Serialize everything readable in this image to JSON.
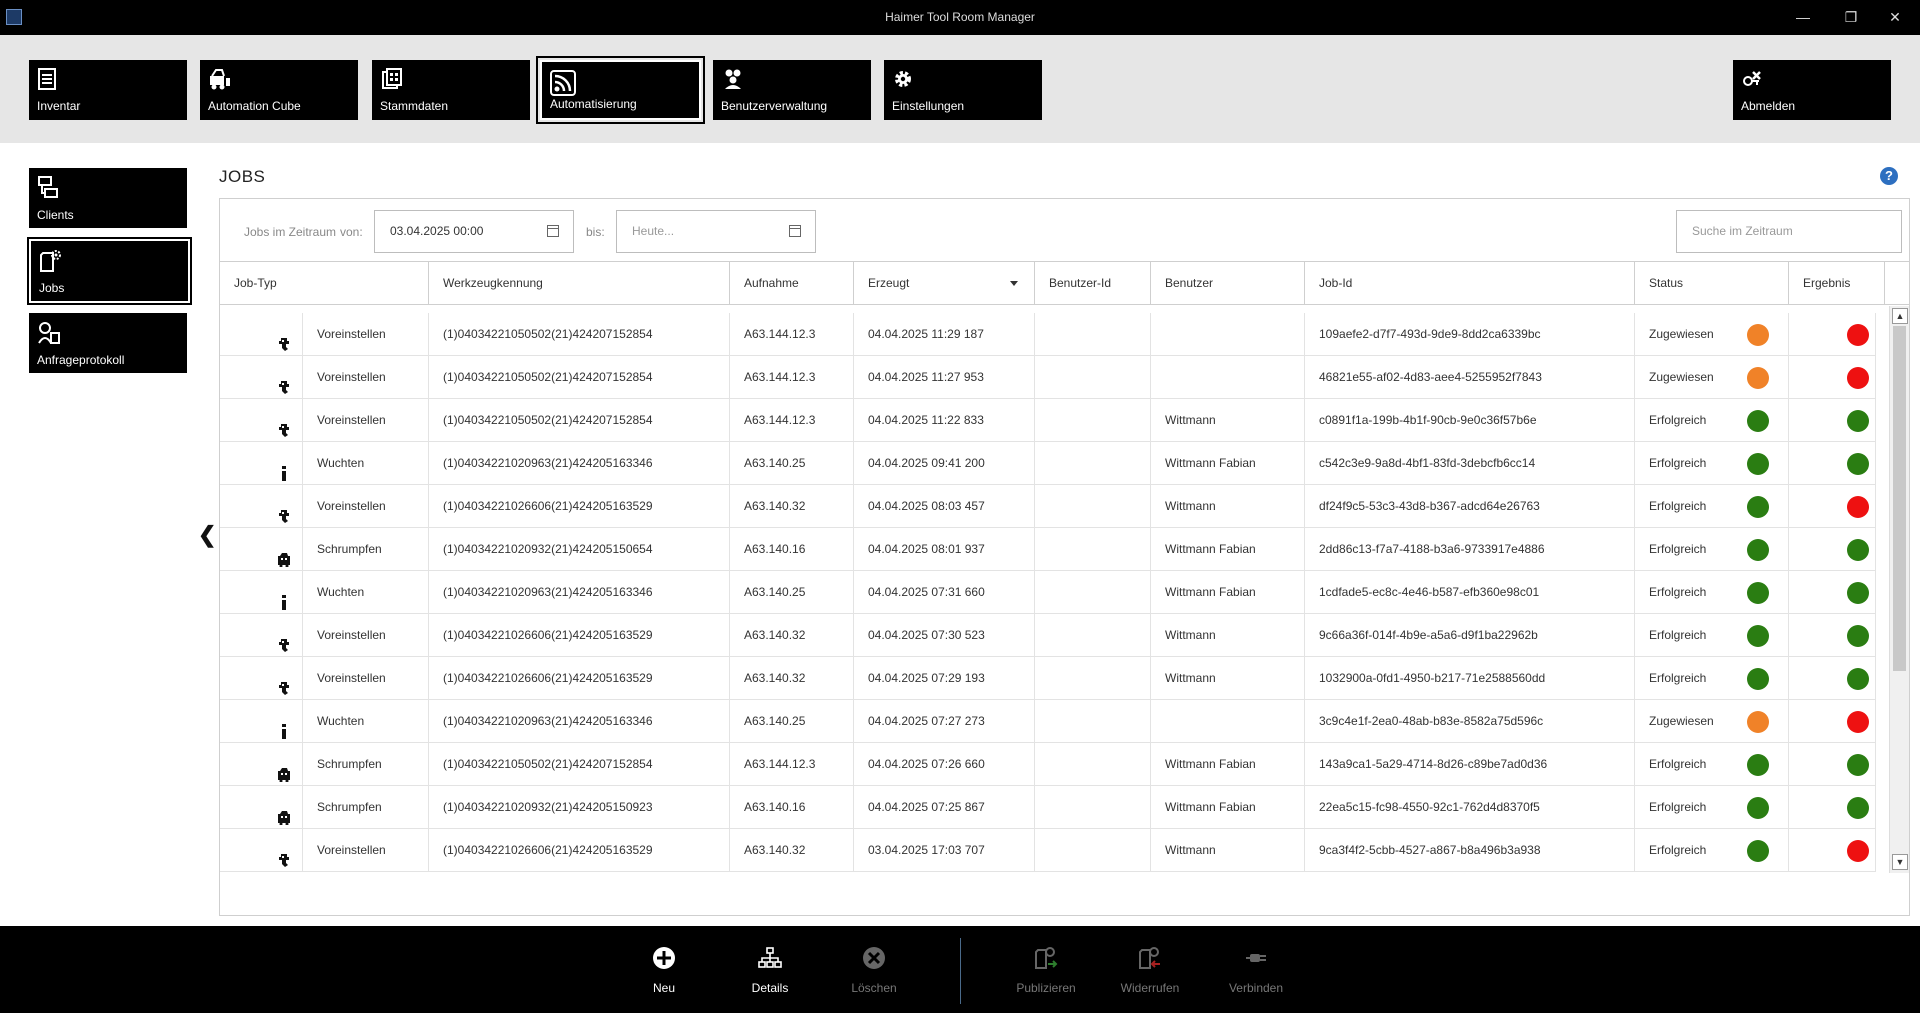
{
  "window": {
    "title": "Haimer Tool Room Manager",
    "minimize": "—",
    "restore": "❐",
    "close": "✕"
  },
  "mainnav": [
    {
      "label": "Inventar",
      "icon": "inventory-icon"
    },
    {
      "label": "Automation Cube",
      "icon": "automation-cube-icon"
    },
    {
      "label": "Stammdaten",
      "icon": "master-data-icon"
    },
    {
      "label": "Automatisierung",
      "icon": "automation-rss-icon",
      "active": true
    },
    {
      "label": "Benutzerverwaltung",
      "icon": "users-icon"
    },
    {
      "label": "Einstellungen",
      "icon": "gear-icon"
    },
    {
      "label": "Abmelden",
      "icon": "logout-icon"
    }
  ],
  "sidenav": [
    {
      "label": "Clients",
      "icon": "clients-icon"
    },
    {
      "label": "Jobs",
      "icon": "jobs-icon",
      "active": true
    },
    {
      "label": "Anfrageprotokoll",
      "icon": "request-log-icon"
    }
  ],
  "page": {
    "title": "JOBS",
    "help": "?"
  },
  "filter": {
    "range_label": "Jobs im Zeitraum",
    "from_label": "von:",
    "from_value": "03.04.2025 00:00",
    "to_label": "bis:",
    "to_placeholder": "Heute...",
    "search_placeholder": "Suche im Zeitraum"
  },
  "table": {
    "columns": [
      "Job-Typ",
      "Werkzeugkennung",
      "Aufnahme",
      "Erzeugt",
      "Benutzer-Id",
      "Benutzer",
      "Job-Id",
      "Status",
      "Ergebnis"
    ],
    "sorted_column": "Erzeugt",
    "rows": [
      {
        "type": "Voreinstellen",
        "icon": "presetting-icon",
        "tool": "(1)04034221050502(21)424207152854",
        "holder": "A63.144.12.3",
        "created": "04.04.2025 11:29 187",
        "user_id": "",
        "user": "",
        "job_id": "109aefe2-d7f7-493d-9de9-8dd2ca6339bc",
        "status": "Zugewiesen",
        "status_color": "#f08228",
        "result_color": "#ee1111"
      },
      {
        "type": "Voreinstellen",
        "icon": "presetting-icon",
        "tool": "(1)04034221050502(21)424207152854",
        "holder": "A63.144.12.3",
        "created": "04.04.2025 11:27 953",
        "user_id": "",
        "user": "",
        "job_id": "46821e55-af02-4d83-aee4-5255952f7843",
        "status": "Zugewiesen",
        "status_color": "#f08228",
        "result_color": "#ee1111"
      },
      {
        "type": "Voreinstellen",
        "icon": "presetting-icon",
        "tool": "(1)04034221050502(21)424207152854",
        "holder": "A63.144.12.3",
        "created": "04.04.2025 11:22 833",
        "user_id": "",
        "user": "Wittmann",
        "job_id": "c0891f1a-199b-4b1f-90cb-9e0c36f57b6e",
        "status": "Erfolgreich",
        "status_color": "#2a7d12",
        "result_color": "#2a7d12"
      },
      {
        "type": "Wuchten",
        "icon": "balancing-icon",
        "tool": "(1)04034221020963(21)424205163346",
        "holder": "A63.140.25",
        "created": "04.04.2025 09:41 200",
        "user_id": "",
        "user": "Wittmann Fabian",
        "job_id": "c542c3e9-9a8d-4bf1-83fd-3debcfb6cc14",
        "status": "Erfolgreich",
        "status_color": "#2a7d12",
        "result_color": "#2a7d12"
      },
      {
        "type": "Voreinstellen",
        "icon": "presetting-icon",
        "tool": "(1)04034221026606(21)424205163529",
        "holder": "A63.140.32",
        "created": "04.04.2025 08:03 457",
        "user_id": "",
        "user": "Wittmann",
        "job_id": "df24f9c5-53c3-43d8-b367-adcd64e26763",
        "status": "Erfolgreich",
        "status_color": "#2a7d12",
        "result_color": "#ee1111"
      },
      {
        "type": "Schrumpfen",
        "icon": "shrinking-icon",
        "tool": "(1)04034221020932(21)424205150654",
        "holder": "A63.140.16",
        "created": "04.04.2025 08:01 937",
        "user_id": "",
        "user": "Wittmann Fabian",
        "job_id": "2dd86c13-f7a7-4188-b3a6-9733917e4886",
        "status": "Erfolgreich",
        "status_color": "#2a7d12",
        "result_color": "#2a7d12"
      },
      {
        "type": "Wuchten",
        "icon": "balancing-icon",
        "tool": "(1)04034221020963(21)424205163346",
        "holder": "A63.140.25",
        "created": "04.04.2025 07:31 660",
        "user_id": "",
        "user": "Wittmann Fabian",
        "job_id": "1cdfade5-ec8c-4e46-b587-efb360e98c01",
        "status": "Erfolgreich",
        "status_color": "#2a7d12",
        "result_color": "#2a7d12"
      },
      {
        "type": "Voreinstellen",
        "icon": "presetting-icon",
        "tool": "(1)04034221026606(21)424205163529",
        "holder": "A63.140.32",
        "created": "04.04.2025 07:30 523",
        "user_id": "",
        "user": "Wittmann",
        "job_id": "9c66a36f-014f-4b9e-a5a6-d9f1ba22962b",
        "status": "Erfolgreich",
        "status_color": "#2a7d12",
        "result_color": "#2a7d12"
      },
      {
        "type": "Voreinstellen",
        "icon": "presetting-icon",
        "tool": "(1)04034221026606(21)424205163529",
        "holder": "A63.140.32",
        "created": "04.04.2025 07:29 193",
        "user_id": "",
        "user": "Wittmann",
        "job_id": "1032900a-0fd1-4950-b217-71e2588560dd",
        "status": "Erfolgreich",
        "status_color": "#2a7d12",
        "result_color": "#2a7d12"
      },
      {
        "type": "Wuchten",
        "icon": "balancing-icon",
        "tool": "(1)04034221020963(21)424205163346",
        "holder": "A63.140.25",
        "created": "04.04.2025 07:27 273",
        "user_id": "",
        "user": "",
        "job_id": "3c9c4e1f-2ea0-48ab-b83e-8582a75d596c",
        "status": "Zugewiesen",
        "status_color": "#f08228",
        "result_color": "#ee1111"
      },
      {
        "type": "Schrumpfen",
        "icon": "shrinking-icon",
        "tool": "(1)04034221050502(21)424207152854",
        "holder": "A63.144.12.3",
        "created": "04.04.2025 07:26 660",
        "user_id": "",
        "user": "Wittmann Fabian",
        "job_id": "143a9ca1-5a29-4714-8d26-c89be7ad0d36",
        "status": "Erfolgreich",
        "status_color": "#2a7d12",
        "result_color": "#2a7d12"
      },
      {
        "type": "Schrumpfen",
        "icon": "shrinking-icon",
        "tool": "(1)04034221020932(21)424205150923",
        "holder": "A63.140.16",
        "created": "04.04.2025 07:25 867",
        "user_id": "",
        "user": "Wittmann Fabian",
        "job_id": "22ea5c15-fc98-4550-92c1-762d4d8370f5",
        "status": "Erfolgreich",
        "status_color": "#2a7d12",
        "result_color": "#2a7d12"
      },
      {
        "type": "Voreinstellen",
        "icon": "presetting-icon",
        "tool": "(1)04034221026606(21)424205163529",
        "holder": "A63.140.32",
        "created": "03.04.2025 17:03 707",
        "user_id": "",
        "user": "Wittmann",
        "job_id": "9ca3f4f2-5cbb-4527-a867-b8a496b3a938",
        "status": "Erfolgreich",
        "status_color": "#2a7d12",
        "result_color": "#ee1111"
      }
    ]
  },
  "toolbar": [
    {
      "label": "Neu",
      "icon": "add-circle-icon",
      "enabled": true
    },
    {
      "label": "Details",
      "icon": "hierarchy-icon",
      "enabled": true
    },
    {
      "label": "Löschen",
      "icon": "delete-x-icon",
      "enabled": false
    },
    {
      "label": "Publizieren",
      "icon": "publish-icon",
      "enabled": false
    },
    {
      "label": "Widerrufen",
      "icon": "revoke-icon",
      "enabled": false
    },
    {
      "label": "Verbinden",
      "icon": "connect-plug-icon",
      "enabled": false
    }
  ]
}
